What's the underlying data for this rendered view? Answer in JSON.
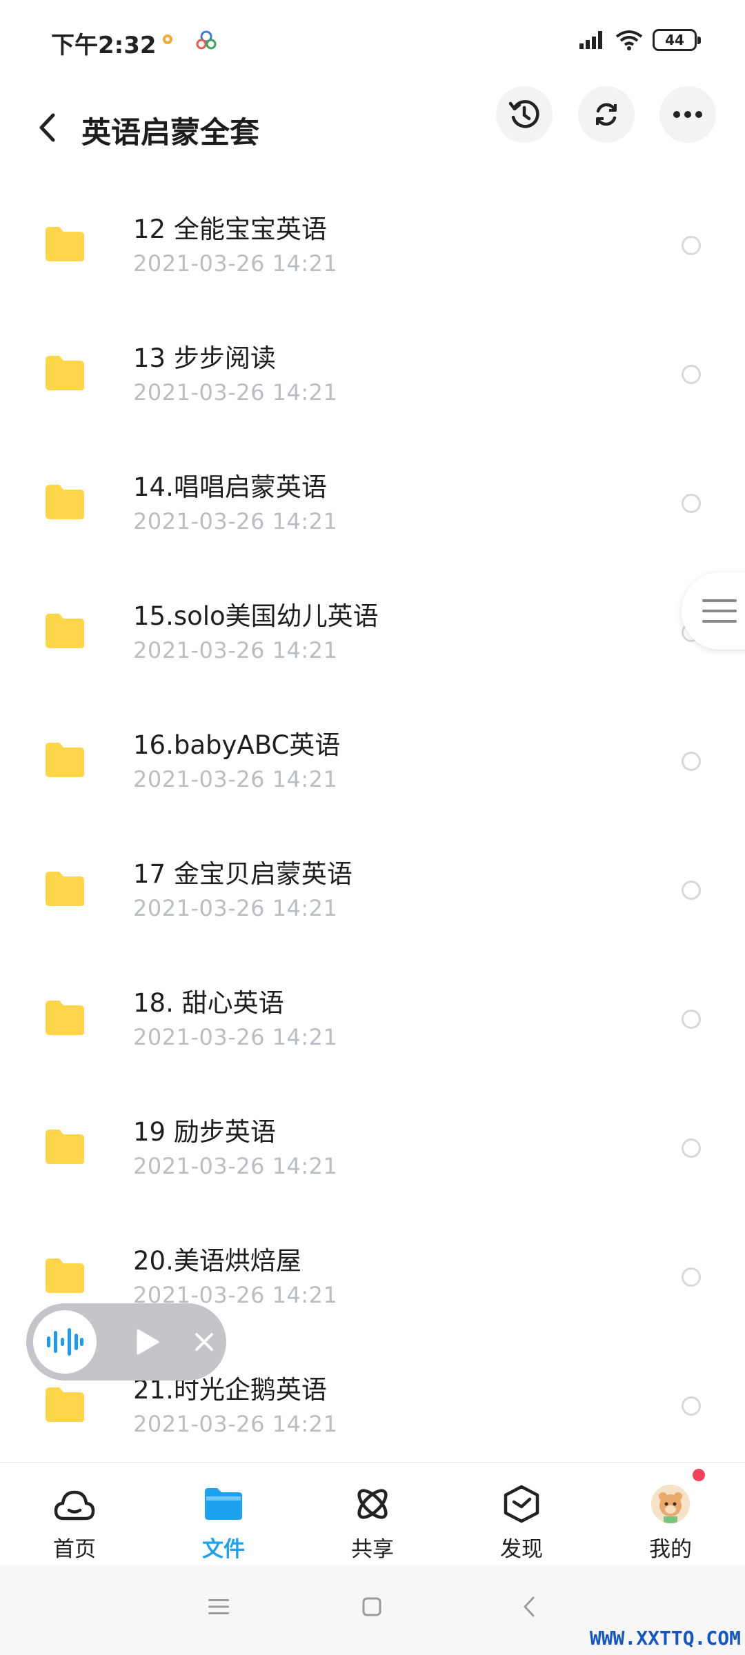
{
  "status_bar": {
    "time": "下午2:32",
    "battery": "44"
  },
  "header": {
    "title": "英语启蒙全套"
  },
  "files": [
    {
      "name": "12 全能宝宝英语",
      "date": "2021-03-26  14:21"
    },
    {
      "name": "13 步步阅读",
      "date": "2021-03-26  14:21"
    },
    {
      "name": "14.唱唱启蒙英语",
      "date": "2021-03-26  14:21"
    },
    {
      "name": "15.solo美国幼儿英语",
      "date": "2021-03-26  14:21"
    },
    {
      "name": "16.babyABC英语",
      "date": "2021-03-26  14:21"
    },
    {
      "name": "17 金宝贝启蒙英语",
      "date": "2021-03-26  14:21"
    },
    {
      "name": "18. 甜心英语",
      "date": "2021-03-26  14:21"
    },
    {
      "name": "19 励步英语",
      "date": "2021-03-26  14:21"
    },
    {
      "name": "20.美语烘焙屋",
      "date": "2021-03-26  14:21"
    },
    {
      "name": "21.时光企鹅英语",
      "date": "2021-03-26  14:21"
    }
  ],
  "bottom_nav": [
    {
      "label": "首页",
      "icon": "cloud-home-icon"
    },
    {
      "label": "文件",
      "icon": "folder-icon",
      "active": true
    },
    {
      "label": "共享",
      "icon": "share-atom-icon"
    },
    {
      "label": "发现",
      "icon": "discover-box-icon"
    },
    {
      "label": "我的",
      "icon": "avatar-icon"
    }
  ],
  "watermark": "WWW.XXTTQ.COM",
  "colors": {
    "accent": "#1ea2f0",
    "folder": "#ffd54a",
    "date": "#b9bdc4",
    "badge": "#f0425a"
  }
}
